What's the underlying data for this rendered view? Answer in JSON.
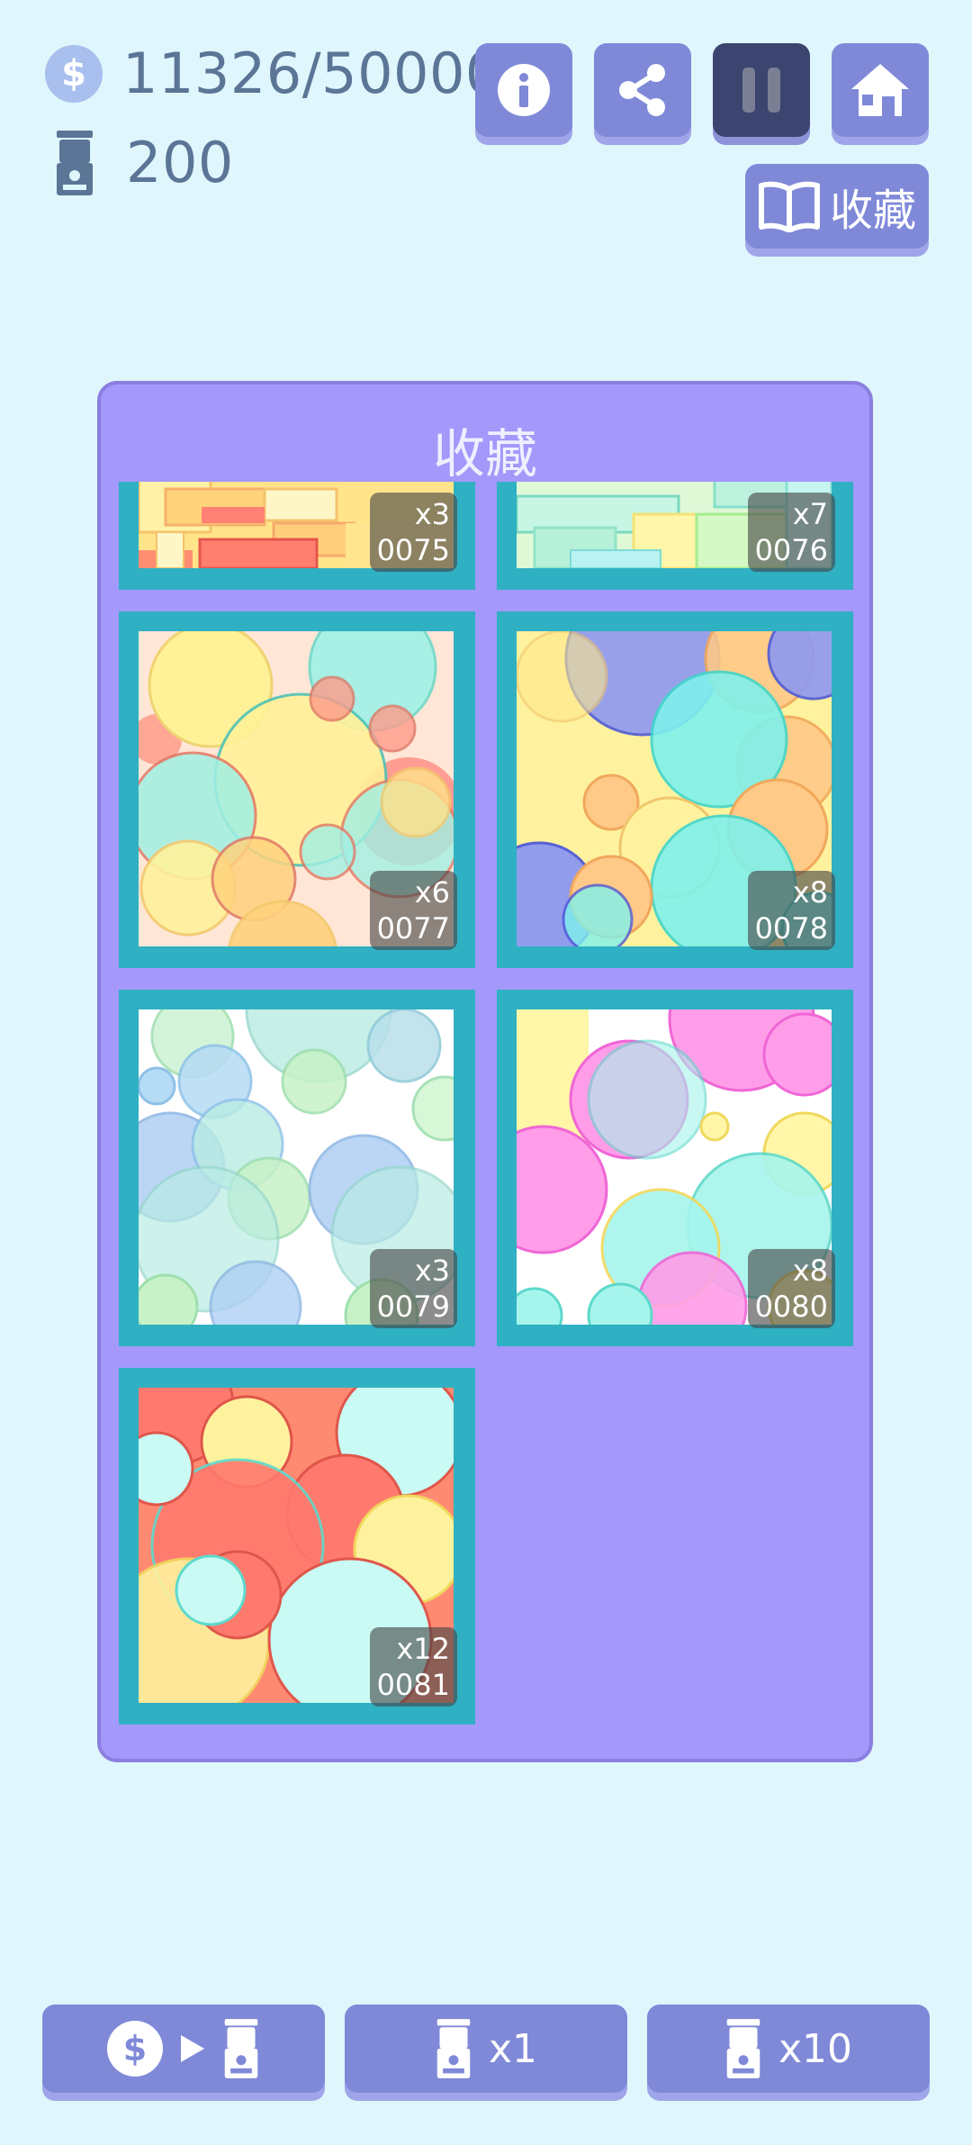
{
  "stats": {
    "coins": "11326/50000",
    "machines": "200",
    "coin_symbol": "$"
  },
  "toolbar": {
    "info_icon": "info-icon",
    "share_icon": "share-icon",
    "pause_icon": "pause-icon",
    "home_icon": "home-icon",
    "collection_label": "收藏"
  },
  "panel": {
    "title": "收藏",
    "items": [
      {
        "count": "x3",
        "id": "0075"
      },
      {
        "count": "x7",
        "id": "0076"
      },
      {
        "count": "x6",
        "id": "0077"
      },
      {
        "count": "x8",
        "id": "0078"
      },
      {
        "count": "x3",
        "id": "0079"
      },
      {
        "count": "x8",
        "id": "0080"
      },
      {
        "count": "x12",
        "id": "0081"
      }
    ]
  },
  "bottom": {
    "exchange_symbol": "$",
    "draw_1_label": "x1",
    "draw_10_label": "x10"
  },
  "colors": {
    "background": "#dff6fd",
    "button": "#7f89d8",
    "panel": "#a498fb",
    "card_frame": "#2fb0c3",
    "text": "#5b7596"
  }
}
